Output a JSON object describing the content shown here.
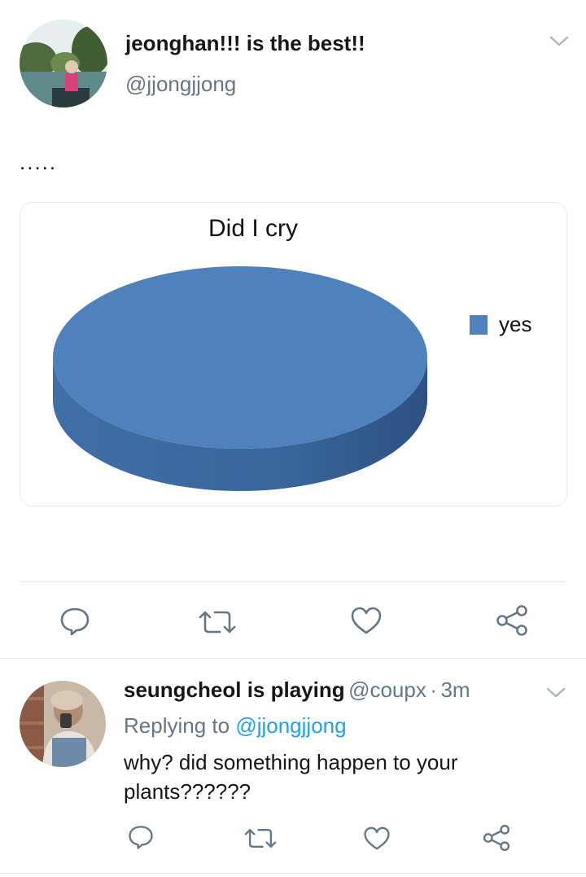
{
  "tweet": {
    "display_name": "jeonghan!!! is the best!!",
    "handle": "@jjongjjong",
    "text": ".....",
    "actions": [
      "reply-icon",
      "retweet-icon",
      "like-icon",
      "share-icon"
    ]
  },
  "chart_data": {
    "type": "pie",
    "title": "Did I cry",
    "categories": [
      "yes"
    ],
    "values": [
      100
    ],
    "legend": "right",
    "colors": {
      "yes": "#4f81bd"
    }
  },
  "reply": {
    "display_name": "seungcheol is playing",
    "handle": "@coupx",
    "separator": "·",
    "time": "3m",
    "replying_prefix": "Replying to",
    "replying_to": "@jjongjjong",
    "text": "why? did something happen to your plants??????",
    "actions": [
      "reply-icon",
      "retweet-icon",
      "like-icon",
      "share-icon"
    ]
  },
  "colors": {
    "icon": "#657786",
    "link": "#1da1f2",
    "divider": "#e1e8ed"
  }
}
